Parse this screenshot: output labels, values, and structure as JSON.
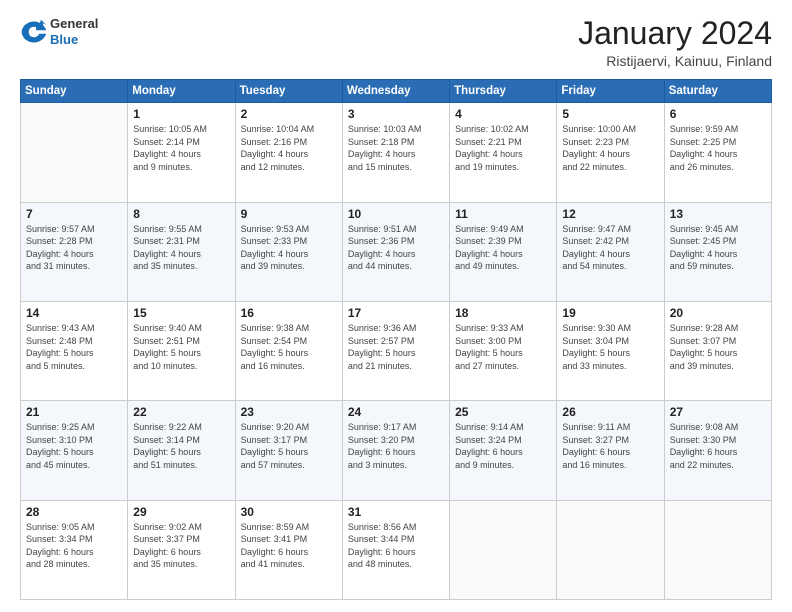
{
  "logo": {
    "general": "General",
    "blue": "Blue"
  },
  "header": {
    "month_title": "January 2024",
    "subtitle": "Ristijaervi, Kainuu, Finland"
  },
  "weekdays": [
    "Sunday",
    "Monday",
    "Tuesday",
    "Wednesday",
    "Thursday",
    "Friday",
    "Saturday"
  ],
  "weeks": [
    [
      {
        "day": "",
        "info": ""
      },
      {
        "day": "1",
        "info": "Sunrise: 10:05 AM\nSunset: 2:14 PM\nDaylight: 4 hours\nand 9 minutes."
      },
      {
        "day": "2",
        "info": "Sunrise: 10:04 AM\nSunset: 2:16 PM\nDaylight: 4 hours\nand 12 minutes."
      },
      {
        "day": "3",
        "info": "Sunrise: 10:03 AM\nSunset: 2:18 PM\nDaylight: 4 hours\nand 15 minutes."
      },
      {
        "day": "4",
        "info": "Sunrise: 10:02 AM\nSunset: 2:21 PM\nDaylight: 4 hours\nand 19 minutes."
      },
      {
        "day": "5",
        "info": "Sunrise: 10:00 AM\nSunset: 2:23 PM\nDaylight: 4 hours\nand 22 minutes."
      },
      {
        "day": "6",
        "info": "Sunrise: 9:59 AM\nSunset: 2:25 PM\nDaylight: 4 hours\nand 26 minutes."
      }
    ],
    [
      {
        "day": "7",
        "info": "Sunrise: 9:57 AM\nSunset: 2:28 PM\nDaylight: 4 hours\nand 31 minutes."
      },
      {
        "day": "8",
        "info": "Sunrise: 9:55 AM\nSunset: 2:31 PM\nDaylight: 4 hours\nand 35 minutes."
      },
      {
        "day": "9",
        "info": "Sunrise: 9:53 AM\nSunset: 2:33 PM\nDaylight: 4 hours\nand 39 minutes."
      },
      {
        "day": "10",
        "info": "Sunrise: 9:51 AM\nSunset: 2:36 PM\nDaylight: 4 hours\nand 44 minutes."
      },
      {
        "day": "11",
        "info": "Sunrise: 9:49 AM\nSunset: 2:39 PM\nDaylight: 4 hours\nand 49 minutes."
      },
      {
        "day": "12",
        "info": "Sunrise: 9:47 AM\nSunset: 2:42 PM\nDaylight: 4 hours\nand 54 minutes."
      },
      {
        "day": "13",
        "info": "Sunrise: 9:45 AM\nSunset: 2:45 PM\nDaylight: 4 hours\nand 59 minutes."
      }
    ],
    [
      {
        "day": "14",
        "info": "Sunrise: 9:43 AM\nSunset: 2:48 PM\nDaylight: 5 hours\nand 5 minutes."
      },
      {
        "day": "15",
        "info": "Sunrise: 9:40 AM\nSunset: 2:51 PM\nDaylight: 5 hours\nand 10 minutes."
      },
      {
        "day": "16",
        "info": "Sunrise: 9:38 AM\nSunset: 2:54 PM\nDaylight: 5 hours\nand 16 minutes."
      },
      {
        "day": "17",
        "info": "Sunrise: 9:36 AM\nSunset: 2:57 PM\nDaylight: 5 hours\nand 21 minutes."
      },
      {
        "day": "18",
        "info": "Sunrise: 9:33 AM\nSunset: 3:00 PM\nDaylight: 5 hours\nand 27 minutes."
      },
      {
        "day": "19",
        "info": "Sunrise: 9:30 AM\nSunset: 3:04 PM\nDaylight: 5 hours\nand 33 minutes."
      },
      {
        "day": "20",
        "info": "Sunrise: 9:28 AM\nSunset: 3:07 PM\nDaylight: 5 hours\nand 39 minutes."
      }
    ],
    [
      {
        "day": "21",
        "info": "Sunrise: 9:25 AM\nSunset: 3:10 PM\nDaylight: 5 hours\nand 45 minutes."
      },
      {
        "day": "22",
        "info": "Sunrise: 9:22 AM\nSunset: 3:14 PM\nDaylight: 5 hours\nand 51 minutes."
      },
      {
        "day": "23",
        "info": "Sunrise: 9:20 AM\nSunset: 3:17 PM\nDaylight: 5 hours\nand 57 minutes."
      },
      {
        "day": "24",
        "info": "Sunrise: 9:17 AM\nSunset: 3:20 PM\nDaylight: 6 hours\nand 3 minutes."
      },
      {
        "day": "25",
        "info": "Sunrise: 9:14 AM\nSunset: 3:24 PM\nDaylight: 6 hours\nand 9 minutes."
      },
      {
        "day": "26",
        "info": "Sunrise: 9:11 AM\nSunset: 3:27 PM\nDaylight: 6 hours\nand 16 minutes."
      },
      {
        "day": "27",
        "info": "Sunrise: 9:08 AM\nSunset: 3:30 PM\nDaylight: 6 hours\nand 22 minutes."
      }
    ],
    [
      {
        "day": "28",
        "info": "Sunrise: 9:05 AM\nSunset: 3:34 PM\nDaylight: 6 hours\nand 28 minutes."
      },
      {
        "day": "29",
        "info": "Sunrise: 9:02 AM\nSunset: 3:37 PM\nDaylight: 6 hours\nand 35 minutes."
      },
      {
        "day": "30",
        "info": "Sunrise: 8:59 AM\nSunset: 3:41 PM\nDaylight: 6 hours\nand 41 minutes."
      },
      {
        "day": "31",
        "info": "Sunrise: 8:56 AM\nSunset: 3:44 PM\nDaylight: 6 hours\nand 48 minutes."
      },
      {
        "day": "",
        "info": ""
      },
      {
        "day": "",
        "info": ""
      },
      {
        "day": "",
        "info": ""
      }
    ]
  ]
}
